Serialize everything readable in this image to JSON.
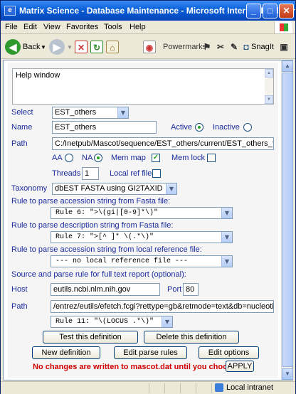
{
  "window": {
    "title": "Matrix Science - Database Maintenance - Microsoft Internet Explorer",
    "minimize": "_",
    "maximize": "□",
    "close": "✕"
  },
  "menu": [
    "File",
    "Edit",
    "View",
    "Favorites",
    "Tools",
    "Help"
  ],
  "toolbar": {
    "back_label": "Back",
    "powermarks_label": "Powermarks",
    "snagit_label": "SnagIt"
  },
  "help": {
    "text": "Help window"
  },
  "form": {
    "select_label": "Select",
    "select_value": "EST_others",
    "name_label": "Name",
    "name_value": "EST_others",
    "active_label": "Active",
    "inactive_label": "Inactive",
    "active_selected": true,
    "path_label": "Path",
    "path_value": "C:/Inetpub/Mascot/sequence/EST_others/current/EST_others_*.fasta",
    "aa_label": "AA",
    "na_label": "NA",
    "na_selected": true,
    "memmap_label": "Mem map",
    "memmap_checked": true,
    "memlock_label": "Mem lock",
    "memlock_checked": false,
    "threads_label": "Threads",
    "threads_value": "1",
    "localref_label": "Local ref file",
    "localref_checked": false,
    "taxonomy_label": "Taxonomy",
    "taxonomy_value": "dbEST FASTA using GI2TAXID",
    "rule_acc_label": "Rule to parse accession string from Fasta file:",
    "rule_acc_value": "Rule 6: \">\\(gi|[0-9]*\\)\"",
    "rule_desc_label": "Rule to parse description string from Fasta file:",
    "rule_desc_value": "Rule 7: \">[^ ]* \\(.*\\)\"",
    "rule_local_label": "Rule to parse accession string from local reference file:",
    "rule_local_value": "--- no local reference file ---",
    "source_label": "Source and parse rule for full text report (optional):",
    "host_label": "Host",
    "host_value": "eutils.ncbi.nlm.nih.gov",
    "port_label": "Port",
    "port_value": "80",
    "path2_label": "Path",
    "path2_value": "/entrez/eutils/efetch.fcgi?rettype=gb&retmode=text&db=nucleotide&id=",
    "rule_fulltext_value": "Rule 11: \"\\(LOCUS .*\\)\""
  },
  "buttons": {
    "test": "Test this definition",
    "delete": "Delete this definition",
    "new": "New definition",
    "edit_rules": "Edit parse rules",
    "edit_options": "Edit options",
    "apply": "APPLY"
  },
  "notice": "No changes are written to mascot.dat until you choose:",
  "status": {
    "zone": "Local intranet"
  },
  "icons": {
    "app": "ie-icon",
    "back": "back-arrow-icon",
    "forward": "forward-arrow-icon",
    "stop": "stop-icon",
    "refresh": "refresh-icon",
    "home": "home-icon",
    "powermarks": "powermarks-icon",
    "snagit": "snagit-icon"
  },
  "colors": {
    "label": "#1a2a9c",
    "notice": "#d00000",
    "titlebar": "#0a5fd8",
    "form_bg": "#f5f5f5"
  }
}
